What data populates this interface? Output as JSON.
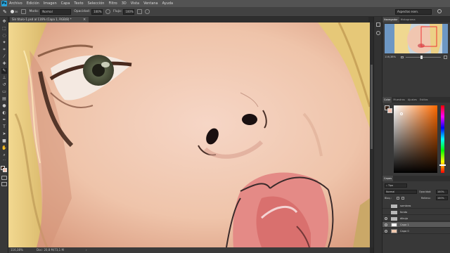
{
  "app": {
    "logo": "Ps"
  },
  "menu": [
    "Archivo",
    "Edición",
    "Imagen",
    "Capa",
    "Texto",
    "Selección",
    "Filtro",
    "3D",
    "Vista",
    "Ventana",
    "Ayuda"
  ],
  "options": {
    "brush_size": "30",
    "mode_label": "Modo:",
    "mode_value": "Normal",
    "opacity_label": "Opacidad:",
    "opacity_value": "100%",
    "flow_label": "Flujo:",
    "flow_value": "100%",
    "workspace": "Aspectos esen."
  },
  "document": {
    "tab_title": "Sin título-1.psd al 116% (Capa 1, RGB/8) *",
    "zoom": "116,38%",
    "doc_info": "Doc: 20,8 M/73,1 M"
  },
  "panels": {
    "navigator": {
      "tabs": [
        "Navegador",
        "Histograma"
      ],
      "zoom": "116,38%"
    },
    "color": {
      "tabs": [
        "Color",
        "Muestras",
        "Ajustes",
        "Estilos"
      ]
    },
    "layers": {
      "tab": "Capas",
      "filter_label": "Tipo",
      "blend_mode": "Normal",
      "opacity_label": "Opacidad:",
      "opacity_value": "100%",
      "lock_label": "Bloq.:",
      "fill_label": "Relleno:",
      "fill_value": "100%",
      "items": [
        {
          "name": "sombras",
          "type": "folder",
          "visible": false,
          "selected": false
        },
        {
          "name": "fondo",
          "type": "folder",
          "visible": false,
          "selected": false
        },
        {
          "name": "dibujo",
          "type": "folder",
          "visible": true,
          "selected": false
        },
        {
          "name": "Capa 1",
          "type": "layer",
          "visible": true,
          "selected": true
        },
        {
          "name": "Capa 0",
          "type": "layer",
          "visible": true,
          "selected": false
        }
      ]
    }
  },
  "colors": {
    "foreground": "#3a2418",
    "background": "#f2c2b0",
    "picker_hue": "#ff6a00"
  },
  "icons": {
    "tools": [
      "move-icon",
      "marquee-icon",
      "lasso-icon",
      "quick-select-icon",
      "crop-icon",
      "eyedropper-icon",
      "healing-icon",
      "brush-icon",
      "clone-stamp-icon",
      "history-brush-icon",
      "eraser-icon",
      "gradient-icon",
      "blur-icon",
      "dodge-icon",
      "pen-icon",
      "type-icon",
      "path-select-icon",
      "rectangle-icon",
      "hand-icon",
      "zoom-icon"
    ]
  }
}
